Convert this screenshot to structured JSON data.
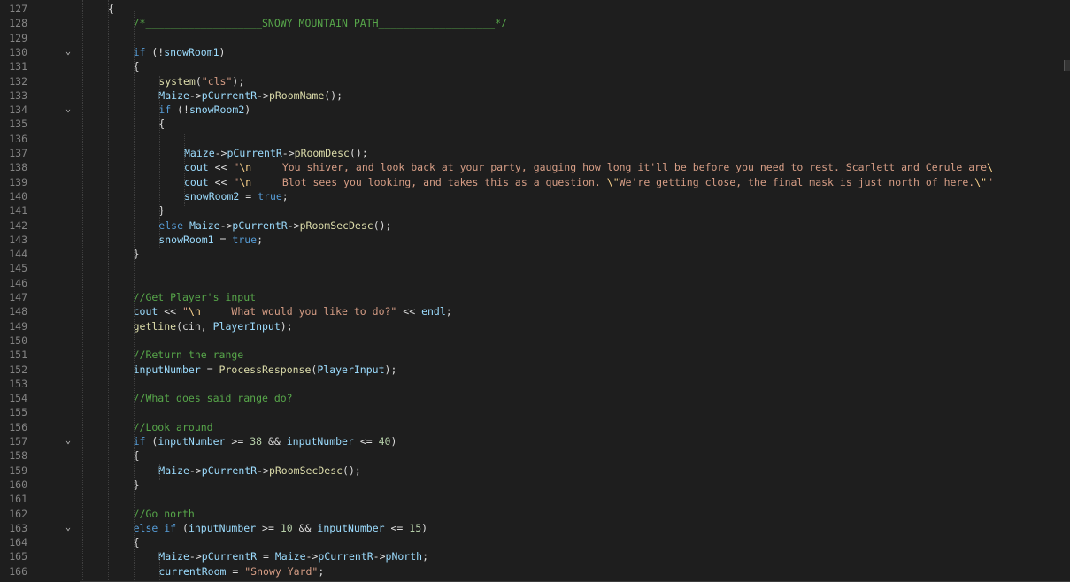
{
  "editor": {
    "language": "C++",
    "colors": {
      "background": "#1e1e1e",
      "line_number": "#858585",
      "keyword": "#569cd6",
      "string": "#d69d85",
      "comment": "#57a64a",
      "variable": "#9cdcfe",
      "function": "#dcdcaa",
      "number": "#b5cea8"
    },
    "lines": [
      {
        "n": "127",
        "indent": 2,
        "fold": false,
        "tokens": [
          [
            "pl",
            "{"
          ]
        ]
      },
      {
        "n": "128",
        "indent": 3,
        "fold": false,
        "tokens": [
          [
            "com",
            "/*___________________SNOWY MOUNTAIN PATH___________________*/"
          ]
        ]
      },
      {
        "n": "129",
        "indent": 3,
        "fold": false,
        "tokens": []
      },
      {
        "n": "130",
        "indent": 3,
        "fold": true,
        "tokens": [
          [
            "kw",
            "if"
          ],
          [
            "pl",
            " (!"
          ],
          [
            "var",
            "snowRoom1"
          ],
          [
            "pl",
            ")"
          ]
        ]
      },
      {
        "n": "131",
        "indent": 3,
        "fold": false,
        "tokens": [
          [
            "pl",
            "{"
          ]
        ]
      },
      {
        "n": "132",
        "indent": 4,
        "fold": false,
        "tokens": [
          [
            "fn",
            "system"
          ],
          [
            "pl",
            "("
          ],
          [
            "str",
            "\"cls\""
          ],
          [
            "pl",
            ");"
          ]
        ]
      },
      {
        "n": "133",
        "indent": 4,
        "fold": false,
        "tokens": [
          [
            "var",
            "Maize"
          ],
          [
            "pl",
            "->"
          ],
          [
            "var",
            "pCurrentR"
          ],
          [
            "pl",
            "->"
          ],
          [
            "fn",
            "pRoomName"
          ],
          [
            "pl",
            "();"
          ]
        ]
      },
      {
        "n": "134",
        "indent": 4,
        "fold": true,
        "tokens": [
          [
            "kw",
            "if"
          ],
          [
            "pl",
            " (!"
          ],
          [
            "var",
            "snowRoom2"
          ],
          [
            "pl",
            ")"
          ]
        ]
      },
      {
        "n": "135",
        "indent": 4,
        "fold": false,
        "tokens": [
          [
            "pl",
            "{"
          ]
        ]
      },
      {
        "n": "136",
        "indent": 5,
        "fold": false,
        "tokens": []
      },
      {
        "n": "137",
        "indent": 5,
        "fold": false,
        "tokens": [
          [
            "var",
            "Maize"
          ],
          [
            "pl",
            "->"
          ],
          [
            "var",
            "pCurrentR"
          ],
          [
            "pl",
            "->"
          ],
          [
            "fn",
            "pRoomDesc"
          ],
          [
            "pl",
            "();"
          ]
        ]
      },
      {
        "n": "138",
        "indent": 5,
        "fold": false,
        "tokens": [
          [
            "var",
            "cout"
          ],
          [
            "pl",
            " << "
          ],
          [
            "str",
            "\""
          ],
          [
            "esc",
            "\\n"
          ],
          [
            "str",
            "     You shiver, and look back at your party, gauging how long it'll be before you need to rest. Scarlett and Cerule are"
          ],
          [
            "esc",
            "\\"
          ]
        ]
      },
      {
        "n": "139",
        "indent": 5,
        "fold": false,
        "tokens": [
          [
            "var",
            "cout"
          ],
          [
            "pl",
            " << "
          ],
          [
            "str",
            "\""
          ],
          [
            "esc",
            "\\n"
          ],
          [
            "str",
            "     Blot sees you looking, and takes this as a question. "
          ],
          [
            "esc",
            "\\\""
          ],
          [
            "str",
            "We're getting close, the final mask is just north of here."
          ],
          [
            "esc",
            "\\\""
          ],
          [
            "str",
            "\""
          ]
        ]
      },
      {
        "n": "140",
        "indent": 5,
        "fold": false,
        "tokens": [
          [
            "var",
            "snowRoom2"
          ],
          [
            "pl",
            " = "
          ],
          [
            "kw",
            "true"
          ],
          [
            "pl",
            ";"
          ]
        ]
      },
      {
        "n": "141",
        "indent": 4,
        "fold": false,
        "tokens": [
          [
            "pl",
            "}"
          ]
        ]
      },
      {
        "n": "142",
        "indent": 4,
        "fold": false,
        "tokens": [
          [
            "kw",
            "else"
          ],
          [
            "pl",
            " "
          ],
          [
            "var",
            "Maize"
          ],
          [
            "pl",
            "->"
          ],
          [
            "var",
            "pCurrentR"
          ],
          [
            "pl",
            "->"
          ],
          [
            "fn",
            "pRoomSecDesc"
          ],
          [
            "pl",
            "();"
          ]
        ]
      },
      {
        "n": "143",
        "indent": 4,
        "fold": false,
        "tokens": [
          [
            "var",
            "snowRoom1"
          ],
          [
            "pl",
            " = "
          ],
          [
            "kw",
            "true"
          ],
          [
            "pl",
            ";"
          ]
        ]
      },
      {
        "n": "144",
        "indent": 3,
        "fold": false,
        "tokens": [
          [
            "pl",
            "}"
          ]
        ]
      },
      {
        "n": "145",
        "indent": 3,
        "fold": false,
        "tokens": []
      },
      {
        "n": "146",
        "indent": 3,
        "fold": false,
        "tokens": []
      },
      {
        "n": "147",
        "indent": 3,
        "fold": false,
        "tokens": [
          [
            "com",
            "//Get Player's input"
          ]
        ]
      },
      {
        "n": "148",
        "indent": 3,
        "fold": false,
        "tokens": [
          [
            "var",
            "cout"
          ],
          [
            "pl",
            " << "
          ],
          [
            "str",
            "\""
          ],
          [
            "esc",
            "\\n"
          ],
          [
            "str",
            "     What would you like to do?\""
          ],
          [
            "pl",
            " << "
          ],
          [
            "var",
            "endl"
          ],
          [
            "pl",
            ";"
          ]
        ]
      },
      {
        "n": "149",
        "indent": 3,
        "fold": false,
        "tokens": [
          [
            "fn",
            "getline"
          ],
          [
            "pl",
            "(cin, "
          ],
          [
            "var",
            "PlayerInput"
          ],
          [
            "pl",
            ");"
          ]
        ]
      },
      {
        "n": "150",
        "indent": 3,
        "fold": false,
        "tokens": []
      },
      {
        "n": "151",
        "indent": 3,
        "fold": false,
        "tokens": [
          [
            "com",
            "//Return the range"
          ]
        ]
      },
      {
        "n": "152",
        "indent": 3,
        "fold": false,
        "tokens": [
          [
            "var",
            "inputNumber"
          ],
          [
            "pl",
            " = "
          ],
          [
            "fn",
            "ProcessResponse"
          ],
          [
            "pl",
            "("
          ],
          [
            "var",
            "PlayerInput"
          ],
          [
            "pl",
            ");"
          ]
        ]
      },
      {
        "n": "153",
        "indent": 3,
        "fold": false,
        "tokens": []
      },
      {
        "n": "154",
        "indent": 3,
        "fold": false,
        "tokens": [
          [
            "com",
            "//What does said range do?"
          ]
        ]
      },
      {
        "n": "155",
        "indent": 3,
        "fold": false,
        "tokens": []
      },
      {
        "n": "156",
        "indent": 3,
        "fold": false,
        "tokens": [
          [
            "com",
            "//Look around"
          ]
        ]
      },
      {
        "n": "157",
        "indent": 3,
        "fold": true,
        "tokens": [
          [
            "kw",
            "if"
          ],
          [
            "pl",
            " ("
          ],
          [
            "var",
            "inputNumber"
          ],
          [
            "pl",
            " >= "
          ],
          [
            "num",
            "38"
          ],
          [
            "pl",
            " && "
          ],
          [
            "var",
            "inputNumber"
          ],
          [
            "pl",
            " <= "
          ],
          [
            "num",
            "40"
          ],
          [
            "pl",
            ")"
          ]
        ]
      },
      {
        "n": "158",
        "indent": 3,
        "fold": false,
        "tokens": [
          [
            "pl",
            "{"
          ]
        ]
      },
      {
        "n": "159",
        "indent": 4,
        "fold": false,
        "tokens": [
          [
            "var",
            "Maize"
          ],
          [
            "pl",
            "->"
          ],
          [
            "var",
            "pCurrentR"
          ],
          [
            "pl",
            "->"
          ],
          [
            "fn",
            "pRoomSecDesc"
          ],
          [
            "pl",
            "();"
          ]
        ]
      },
      {
        "n": "160",
        "indent": 3,
        "fold": false,
        "tokens": [
          [
            "pl",
            "}"
          ]
        ]
      },
      {
        "n": "161",
        "indent": 3,
        "fold": false,
        "tokens": []
      },
      {
        "n": "162",
        "indent": 3,
        "fold": false,
        "tokens": [
          [
            "com",
            "//Go north"
          ]
        ]
      },
      {
        "n": "163",
        "indent": 3,
        "fold": true,
        "tokens": [
          [
            "kw",
            "else"
          ],
          [
            "pl",
            " "
          ],
          [
            "kw",
            "if"
          ],
          [
            "pl",
            " ("
          ],
          [
            "var",
            "inputNumber"
          ],
          [
            "pl",
            " >= "
          ],
          [
            "num",
            "10"
          ],
          [
            "pl",
            " && "
          ],
          [
            "var",
            "inputNumber"
          ],
          [
            "pl",
            " <= "
          ],
          [
            "num",
            "15"
          ],
          [
            "pl",
            ")"
          ]
        ]
      },
      {
        "n": "164",
        "indent": 3,
        "fold": false,
        "tokens": [
          [
            "pl",
            "{"
          ]
        ]
      },
      {
        "n": "165",
        "indent": 4,
        "fold": false,
        "tokens": [
          [
            "var",
            "Maize"
          ],
          [
            "pl",
            "->"
          ],
          [
            "var",
            "pCurrentR"
          ],
          [
            "pl",
            " = "
          ],
          [
            "var",
            "Maize"
          ],
          [
            "pl",
            "->"
          ],
          [
            "var",
            "pCurrentR"
          ],
          [
            "pl",
            "->"
          ],
          [
            "var",
            "pNorth"
          ],
          [
            "pl",
            ";"
          ]
        ]
      },
      {
        "n": "166",
        "indent": 4,
        "fold": false,
        "tokens": [
          [
            "var",
            "currentRoom"
          ],
          [
            "pl",
            " = "
          ],
          [
            "str",
            "\"Snowy Yard\""
          ],
          [
            "pl",
            ";"
          ]
        ]
      }
    ]
  }
}
